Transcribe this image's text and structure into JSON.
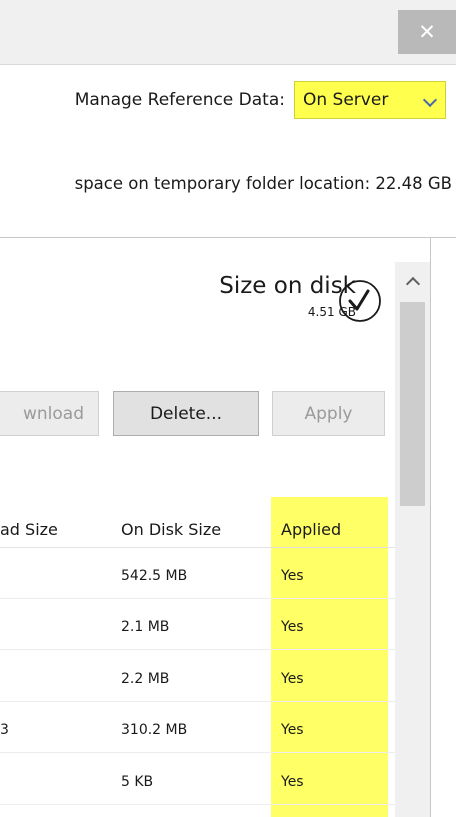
{
  "window": {
    "close_glyph": "✕"
  },
  "reference": {
    "label": "Manage Reference Data:",
    "selected": "On Server",
    "highlight_color": "#ffff4d"
  },
  "space_info": "space on temporary folder location: 22.48 GB",
  "disk": {
    "title": "Size on disk",
    "value": "4.51 GB"
  },
  "buttons": {
    "download": "wnload",
    "delete": "Delete...",
    "apply": "Apply"
  },
  "table": {
    "columns": [
      "ad Size",
      "On Disk Size",
      "Applied"
    ],
    "rows": [
      {
        "download": "",
        "on_disk": "542.5 MB",
        "applied": "Yes"
      },
      {
        "download": "",
        "on_disk": "2.1 MB",
        "applied": "Yes"
      },
      {
        "download": "",
        "on_disk": "2.2 MB",
        "applied": "Yes"
      },
      {
        "download": "3",
        "on_disk": "310.2 MB",
        "applied": "Yes"
      },
      {
        "download": "",
        "on_disk": "5 KB",
        "applied": "Yes"
      }
    ],
    "applied_highlight": "#ffff66"
  }
}
